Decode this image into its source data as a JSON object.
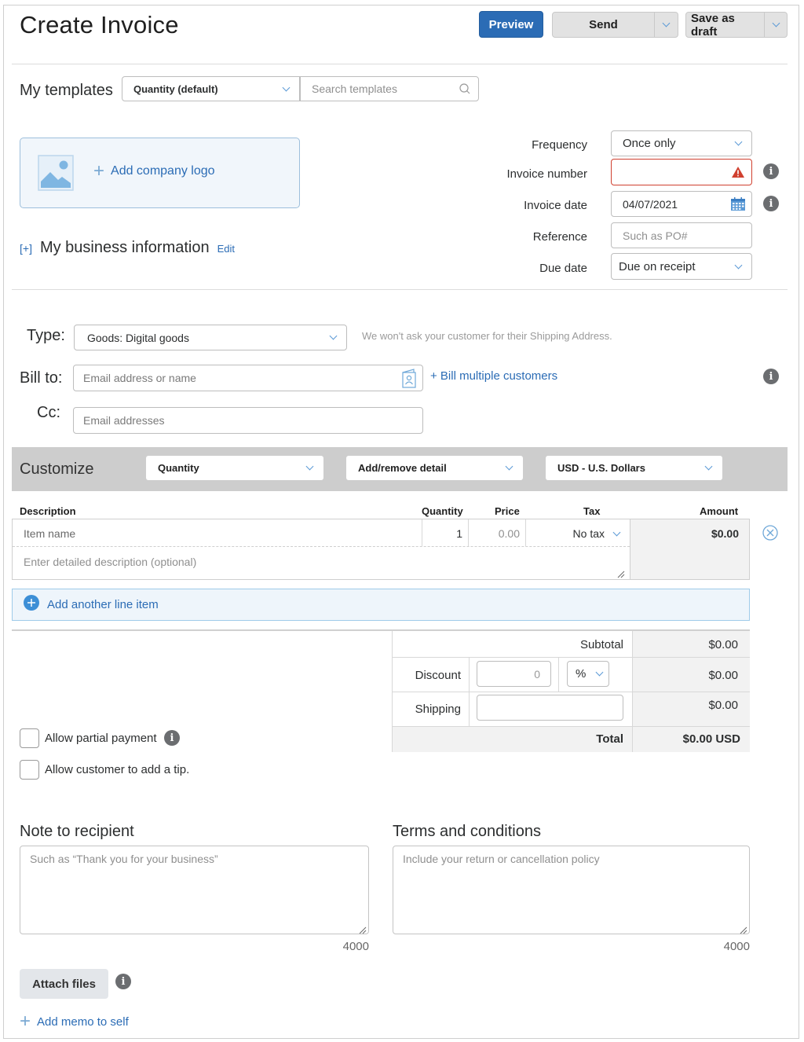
{
  "header": {
    "title": "Create Invoice",
    "preview_label": "Preview",
    "send_label": "Send",
    "save_draft_label": "Save as draft",
    "primary_color": "#2b6cb5"
  },
  "templates": {
    "label": "My templates",
    "selected": "Quantity (default)",
    "search_placeholder": "Search templates"
  },
  "logo": {
    "add_label": "Add company logo"
  },
  "business_info": {
    "expander": "[+]",
    "label": "My business information",
    "edit_label": "Edit"
  },
  "invoice_meta": {
    "frequency_label": "Frequency",
    "frequency_value": "Once only",
    "invoice_number_label": "Invoice number",
    "invoice_number_value": "",
    "invoice_date_label": "Invoice date",
    "invoice_date_value": "04/07/2021",
    "reference_label": "Reference",
    "reference_placeholder": "Such as PO#",
    "due_date_label": "Due date",
    "due_date_value": "Due on receipt",
    "error_color": "#d0402f"
  },
  "customer": {
    "type_label": "Type:",
    "type_value": "Goods: Digital goods",
    "type_hint": "We won't ask your customer for their Shipping Address.",
    "bill_to_label": "Bill to:",
    "bill_to_placeholder": "Email address or name",
    "bill_multiple_label": "+ Bill multiple customers",
    "cc_label": "Cc:",
    "cc_placeholder": "Email addresses"
  },
  "customize": {
    "label": "Customize",
    "quantity_select": "Quantity",
    "detail_select": "Add/remove detail",
    "currency_select": "USD - U.S. Dollars"
  },
  "line_items": {
    "headers": {
      "description": "Description",
      "quantity": "Quantity",
      "price": "Price",
      "tax": "Tax",
      "amount": "Amount"
    },
    "rows": [
      {
        "item_placeholder": "Item name",
        "description_placeholder": "Enter detailed description (optional)",
        "quantity": "1",
        "price_placeholder": "0.00",
        "tax": "No tax",
        "amount": "$0.00"
      }
    ],
    "add_label": "Add another line item"
  },
  "totals": {
    "subtotal_label": "Subtotal",
    "subtotal_value": "$0.00",
    "discount_label": "Discount",
    "discount_placeholder": "0",
    "discount_unit": "%",
    "discount_value": "$0.00",
    "shipping_label": "Shipping",
    "shipping_value": "$0.00",
    "total_label": "Total",
    "total_value": "$0.00 USD"
  },
  "options": {
    "partial_payment_label": "Allow partial payment",
    "partial_payment_checked": false,
    "tip_label": "Allow customer to add a tip.",
    "tip_checked": false
  },
  "notes": {
    "note_title": "Note to recipient",
    "note_placeholder": "Such as “Thank you for your business”",
    "note_counter": "4000",
    "terms_title": "Terms and conditions",
    "terms_placeholder": "Include your return or cancellation policy",
    "terms_counter": "4000"
  },
  "footer": {
    "attach_label": "Attach files",
    "memo_label": "Add memo to self"
  }
}
